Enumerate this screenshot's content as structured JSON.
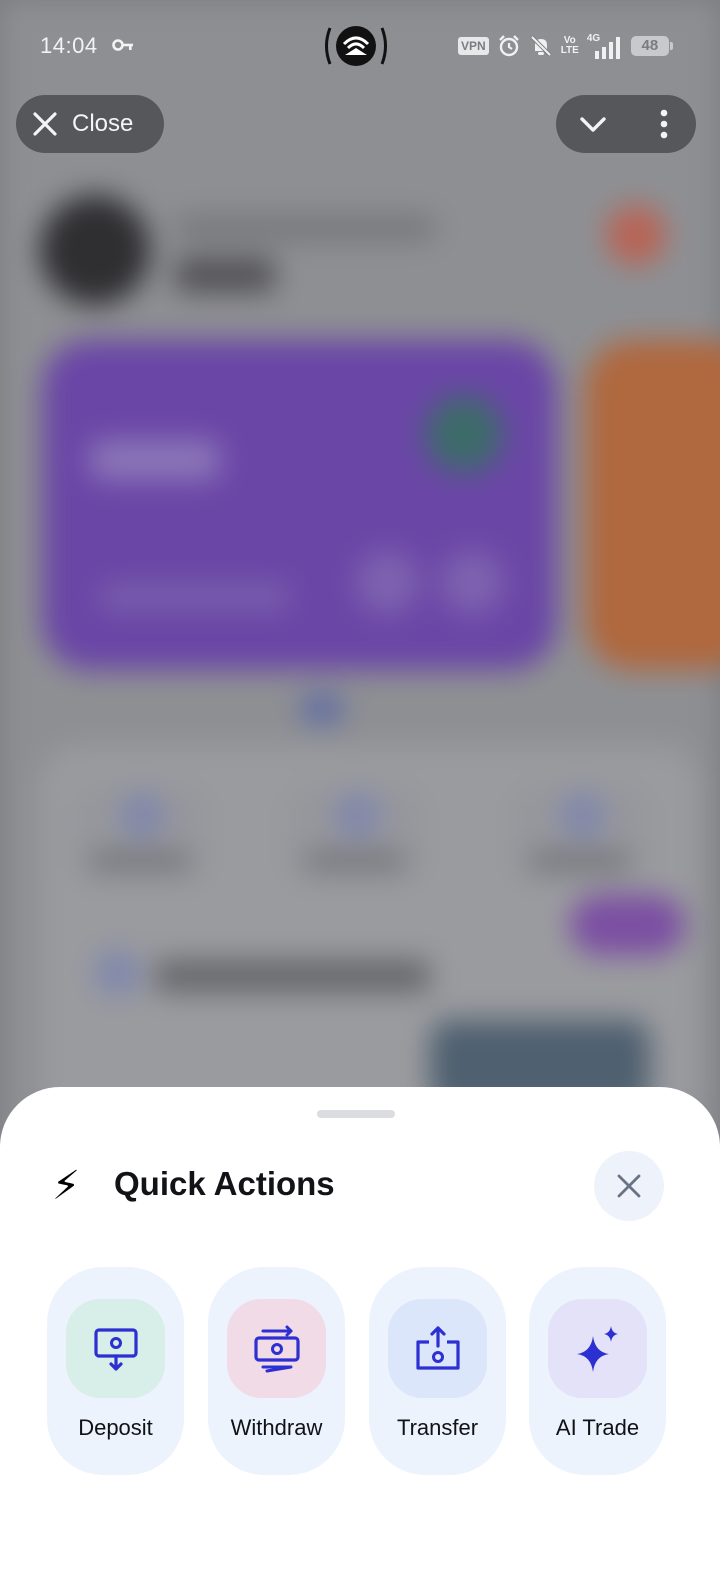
{
  "status_bar": {
    "time": "14:04",
    "vpn": "VPN",
    "volte_top": "Vo",
    "volte_bottom": "LTE",
    "network": "4G",
    "battery": "48"
  },
  "top_controls": {
    "close_label": "Close"
  },
  "sheet": {
    "title_icon": "⚡",
    "title": "Quick Actions",
    "actions": [
      {
        "label": "Deposit",
        "icon": "deposit-icon"
      },
      {
        "label": "Withdraw",
        "icon": "withdraw-icon"
      },
      {
        "label": "Transfer",
        "icon": "transfer-icon"
      },
      {
        "label": "AI Trade",
        "icon": "sparkle-icon"
      }
    ]
  },
  "colors": {
    "accent": "#2c2fd1",
    "sheet_bg": "#ffffff",
    "action_bg": "#edf3fd",
    "overlay": "#7a7c80"
  }
}
